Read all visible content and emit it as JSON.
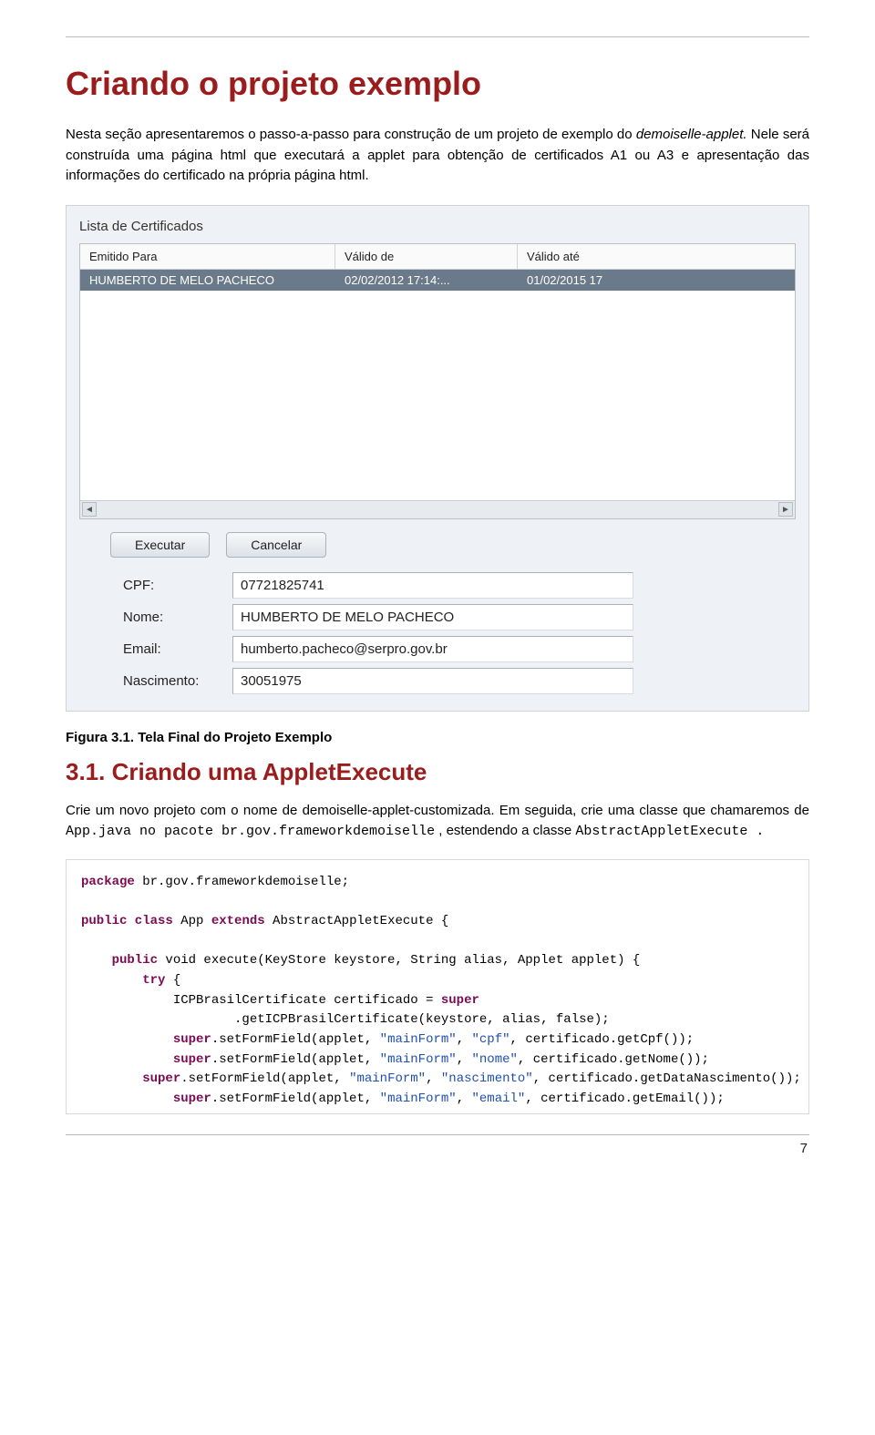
{
  "heading": "Criando o projeto exemplo",
  "intro_a": "Nesta seção apresentaremos o passo-a-passo para construção de um projeto de exemplo do ",
  "intro_a_em": "demoiselle-applet.",
  "intro_a2": " Nele será construída uma página html que executará a applet para obtenção de certificados A1 ou A3 e apresentação das informações do certificado na própria página html.",
  "shot": {
    "title": "Lista de Certificados",
    "head": {
      "col1": "Emitido Para",
      "col2": "Válido de",
      "col3": "Válido até"
    },
    "row": {
      "col1": "HUMBERTO DE MELO PACHECO",
      "col2": "02/02/2012 17:14:...",
      "col3": "01/02/2015 17"
    },
    "btn1": "Executar",
    "btn2": "Cancelar",
    "fields": {
      "cpf_label": "CPF:",
      "cpf": "07721825741",
      "nome_label": "Nome:",
      "nome": "HUMBERTO DE MELO PACHECO",
      "email_label": "Email:",
      "email": "humberto.pacheco@serpro.gov.br",
      "nasc_label": "Nascimento:",
      "nasc": "30051975"
    }
  },
  "caption": "Figura 3.1. Tela Final do Projeto Exemplo",
  "sec": "3.1. Criando uma AppletExecute",
  "p2": {
    "a": "Crie um novo projeto com o nome de demoiselle-applet-customizada. Em seguida, crie uma classe que chamaremos de ",
    "c1": "App.java no pacote  br.gov.frameworkdemoiselle",
    "b": " , estendendo a classe ",
    "c2": "AbstractAppletExecute .",
    "c": ""
  },
  "code": {
    "l1a": "package",
    "l1b": " br.gov.frameworkdemoiselle;",
    "l2a": "public class",
    "l2b": " App ",
    "l2c": "extends",
    "l2d": " AbstractAppletExecute {",
    "l3a": "    public",
    "l3b": " void execute(KeyStore keystore, String alias, Applet applet) {",
    "l4a": "        try",
    "l4b": " {",
    "l5": "            ICPBrasilCertificate certificado = ",
    "l5b": "super",
    "l6": "                    .getICPBrasilCertificate(keystore, alias, false);",
    "l7a": "            super",
    "l7b": ".setFormField(applet, ",
    "l7s1": "\"mainForm\"",
    "l7c": ", ",
    "l7s2": "\"cpf\"",
    "l7d": ", certificado.getCpf());",
    "l8a": "            super",
    "l8b": ".setFormField(applet, ",
    "l8s1": "\"mainForm\"",
    "l8c": ", ",
    "l8s2": "\"nome\"",
    "l8d": ", certificado.getNome());",
    "l9a": "        super",
    "l9b": ".setFormField(applet, ",
    "l9s1": "\"mainForm\"",
    "l9c": ", ",
    "l9s2": "\"nascimento\"",
    "l9d": ", certificado.getDataNascimento());",
    "l10a": "            super",
    "l10b": ".setFormField(applet, ",
    "l10s1": "\"mainForm\"",
    "l10c": ", ",
    "l10s2": "\"email\"",
    "l10d": ", certificado.getEmail());"
  },
  "pagenum": "7"
}
